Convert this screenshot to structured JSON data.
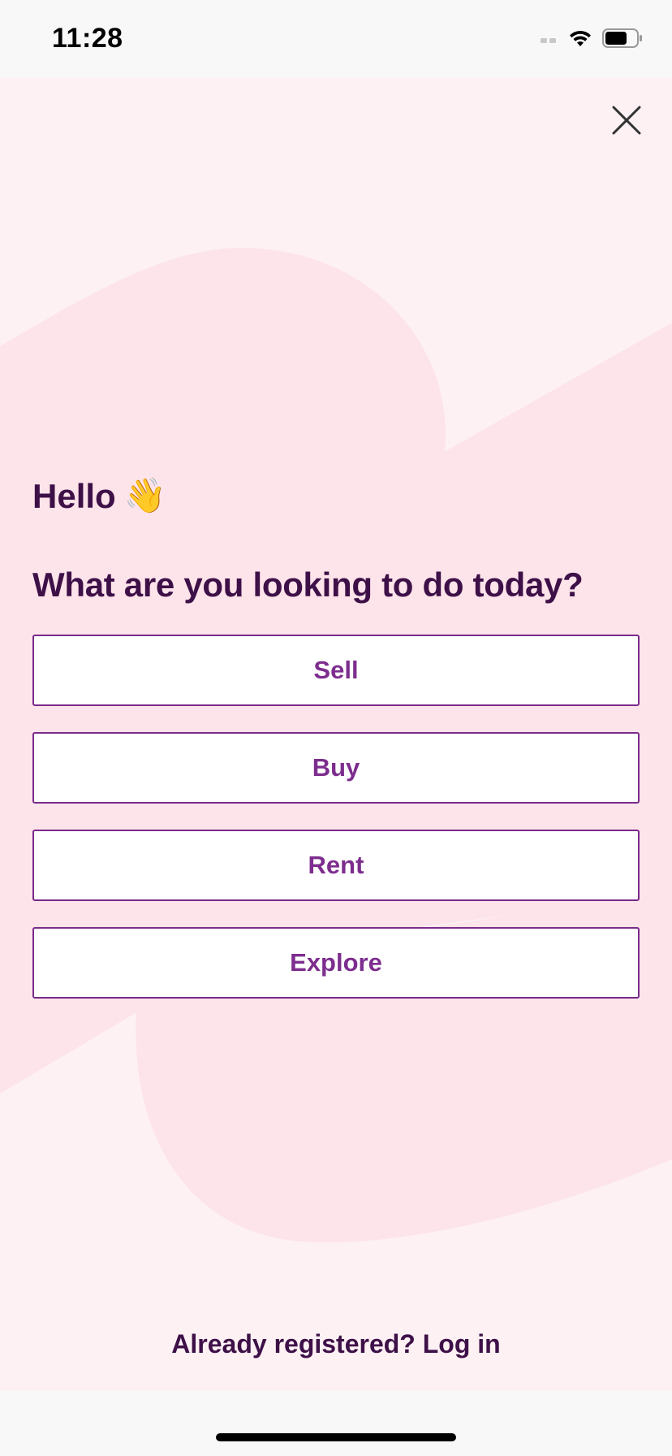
{
  "status_bar": {
    "time": "11:28"
  },
  "header": {
    "close_icon": "close-icon"
  },
  "greeting": {
    "text": "Hello",
    "emoji": "👋"
  },
  "question": "What are you looking to do today?",
  "options": [
    {
      "label": "Sell"
    },
    {
      "label": "Buy"
    },
    {
      "label": "Rent"
    },
    {
      "label": "Explore"
    }
  ],
  "footer": {
    "login_text": "Already registered? Log in"
  },
  "colors": {
    "background": "#fdf1f4",
    "blob": "#fde4ea",
    "heading": "#3e1048",
    "accent": "#7a2a8c"
  }
}
